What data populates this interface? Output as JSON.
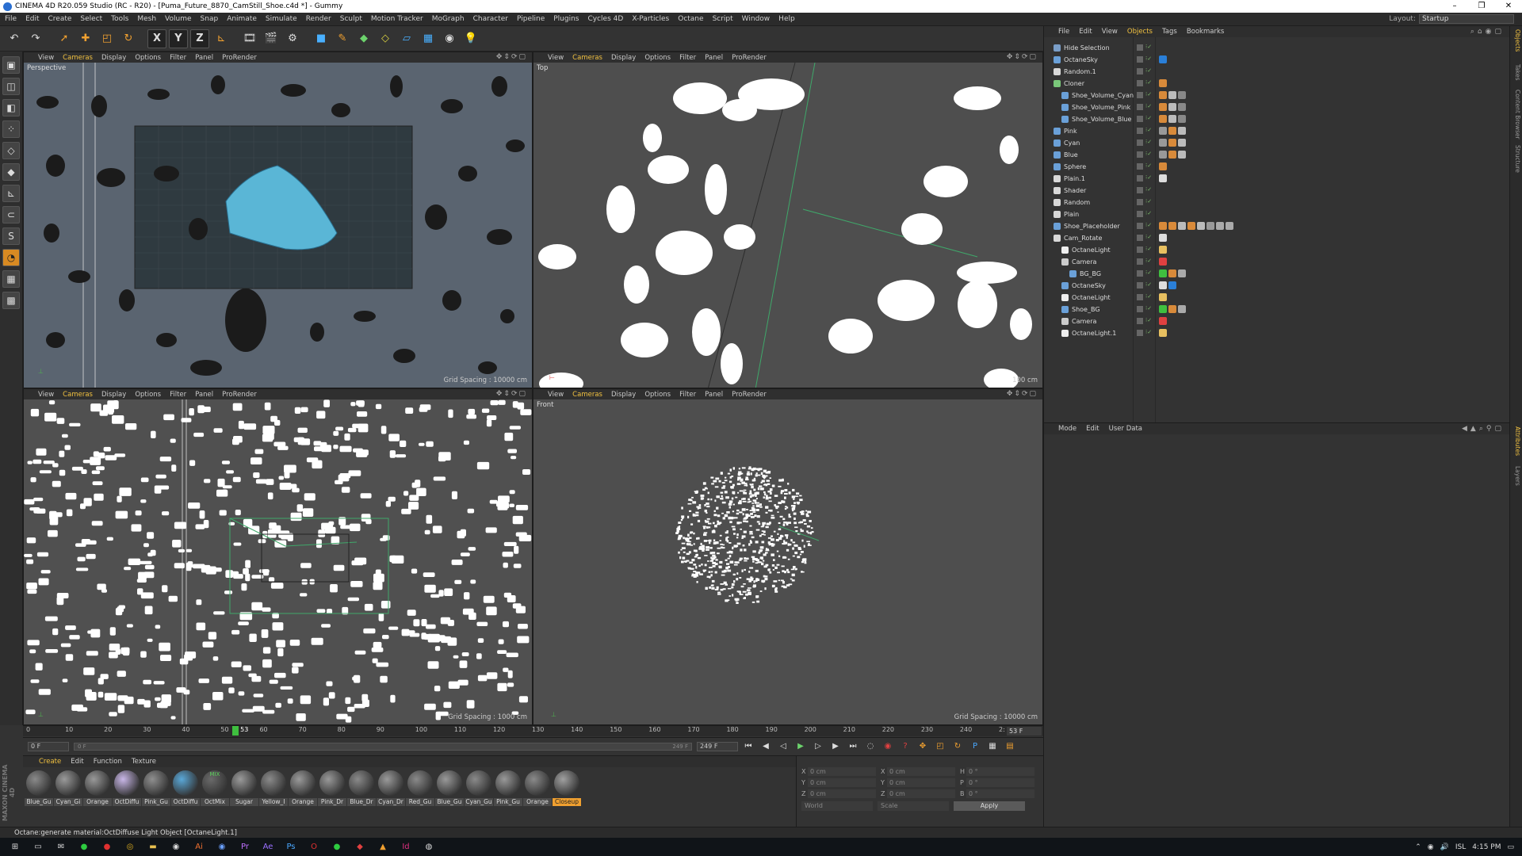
{
  "window": {
    "title": "CINEMA 4D R20.059 Studio (RC - R20) - [Puma_Future_8870_CamStill_Shoe.c4d *] - Gummy",
    "controls": [
      "–",
      "❐",
      "✕"
    ]
  },
  "menubar": {
    "items": [
      "File",
      "Edit",
      "Create",
      "Select",
      "Tools",
      "Mesh",
      "Volume",
      "Snap",
      "Animate",
      "Simulate",
      "Render",
      "Sculpt",
      "Motion Tracker",
      "MoGraph",
      "Character",
      "Pipeline",
      "Plugins",
      "Cycles 4D",
      "X-Particles",
      "Octane",
      "Script",
      "Window",
      "Help"
    ],
    "layout_label": "Layout:",
    "layout_value": "Startup"
  },
  "toolbar": {
    "axis_x": "X",
    "axis_y": "Y",
    "axis_z": "Z"
  },
  "viewports": {
    "menu": [
      "View",
      "Cameras",
      "Display",
      "Options",
      "Filter",
      "Panel",
      "ProRender"
    ],
    "perspective": {
      "label": "Perspective",
      "grid": "Grid Spacing : 10000 cm"
    },
    "top": {
      "label": "Top",
      "grid": "100 cm"
    },
    "right": {
      "label": "",
      "grid": "Grid Spacing : 1000 cm"
    },
    "front": {
      "label": "Front",
      "grid": "Grid Spacing : 10000 cm"
    }
  },
  "timeline": {
    "ticks": [
      "0",
      "10",
      "20",
      "30",
      "40",
      "50",
      "60",
      "70",
      "80",
      "90",
      "100",
      "110",
      "120",
      "130",
      "140",
      "150",
      "160",
      "170",
      "180",
      "190",
      "200",
      "210",
      "220",
      "230",
      "240",
      "2:"
    ],
    "current": "53",
    "current_fraction": 0.212,
    "end_field": "53 F"
  },
  "transport": {
    "start": "0 F",
    "range_start": "0 F",
    "range_end": "249 F",
    "end": "249 F"
  },
  "materials": {
    "menu": [
      "Create",
      "Edit",
      "Function",
      "Texture"
    ],
    "items": [
      {
        "name": "Blue_Gu",
        "color": "#8a8a8a"
      },
      {
        "name": "Cyan_Gi",
        "color": "#9a9a9a"
      },
      {
        "name": "Orange",
        "color": "#999999"
      },
      {
        "name": "OctDiffu",
        "color": "#c9b7e8"
      },
      {
        "name": "Pink_Gu",
        "color": "#8f8f8f"
      },
      {
        "name": "OctDiffu",
        "color": "#5aa8d8"
      },
      {
        "name": "OctMix",
        "color": "#6a6a6a"
      },
      {
        "name": "Sugar",
        "color": "#9a9a9a"
      },
      {
        "name": "Yellow_I",
        "color": "#8a8a8a"
      },
      {
        "name": "Orange",
        "color": "#9a9a9a"
      },
      {
        "name": "Pink_Dr",
        "color": "#999999"
      },
      {
        "name": "Blue_Dr",
        "color": "#8a8a8a"
      },
      {
        "name": "Cyan_Dr",
        "color": "#9a9a9a"
      },
      {
        "name": "Red_Gu",
        "color": "#8a8a8a"
      },
      {
        "name": "Blue_Gu",
        "color": "#999999"
      },
      {
        "name": "Cyan_Gu",
        "color": "#8a8a8a"
      },
      {
        "name": "Pink_Gu",
        "color": "#999999"
      },
      {
        "name": "Orange",
        "color": "#8a8a8a"
      },
      {
        "name": "Closeup",
        "color": "#a0a0a0"
      }
    ],
    "selected_index": 18,
    "mix_label": "MIX"
  },
  "coords": {
    "rows": [
      [
        {
          "l": "X",
          "v": "0 cm"
        },
        {
          "l": "X",
          "v": "0 cm"
        },
        {
          "l": "H",
          "v": "0 °"
        }
      ],
      [
        {
          "l": "Y",
          "v": "0 cm"
        },
        {
          "l": "Y",
          "v": "0 cm"
        },
        {
          "l": "P",
          "v": "0 °"
        }
      ],
      [
        {
          "l": "Z",
          "v": "0 cm"
        },
        {
          "l": "Z",
          "v": "0 cm"
        },
        {
          "l": "B",
          "v": "0 °"
        }
      ]
    ],
    "world": "World",
    "scale": "Scale",
    "apply": "Apply"
  },
  "status": {
    "text": "Octane:generate material:OctDiffuse     Light Object [OctaneLight.1]"
  },
  "maxon": "MAXON CINEMA 4D",
  "objects": {
    "menu": [
      "File",
      "Edit",
      "View",
      "Objects",
      "Tags",
      "Bookmarks"
    ],
    "items": [
      {
        "name": "Hide Selection",
        "indent": 0,
        "icon": "#7a9ec8",
        "tags": []
      },
      {
        "name": "OctaneSky",
        "indent": 0,
        "icon": "#6aa0d8",
        "tags": [
          "#2a7fd8"
        ]
      },
      {
        "name": "Random.1",
        "indent": 0,
        "icon": "#d8d8d8",
        "tags": []
      },
      {
        "name": "Cloner",
        "indent": 0,
        "icon": "#7ac87a",
        "tags": [
          "#d88a3a"
        ]
      },
      {
        "name": "Shoe_Volume_Cyan",
        "indent": 1,
        "icon": "#6aa0d8",
        "tags": [
          "#d88a3a",
          "#bbbbbb",
          "#888888"
        ]
      },
      {
        "name": "Shoe_Volume_Pink",
        "indent": 1,
        "icon": "#6aa0d8",
        "tags": [
          "#d88a3a",
          "#bbbbbb",
          "#888888"
        ]
      },
      {
        "name": "Shoe_Volume_Blue",
        "indent": 1,
        "icon": "#6aa0d8",
        "tags": [
          "#d88a3a",
          "#bbbbbb",
          "#888888"
        ]
      },
      {
        "name": "Pink",
        "indent": 0,
        "icon": "#6aa0d8",
        "tags": [
          "#999999",
          "#d88a3a",
          "#bbbbbb"
        ]
      },
      {
        "name": "Cyan",
        "indent": 0,
        "icon": "#6aa0d8",
        "tags": [
          "#999999",
          "#d88a3a",
          "#bbbbbb"
        ]
      },
      {
        "name": "Blue",
        "indent": 0,
        "icon": "#6aa0d8",
        "tags": [
          "#999999",
          "#d88a3a",
          "#bbbbbb"
        ]
      },
      {
        "name": "Sphere",
        "indent": 0,
        "icon": "#6aa0d8",
        "tags": [
          "#d88a3a"
        ]
      },
      {
        "name": "Plain.1",
        "indent": 0,
        "icon": "#d8d8d8",
        "tags": [
          "#dddddd"
        ]
      },
      {
        "name": "Shader",
        "indent": 0,
        "icon": "#d8d8d8",
        "tags": []
      },
      {
        "name": "Random",
        "indent": 0,
        "icon": "#d8d8d8",
        "tags": []
      },
      {
        "name": "Plain",
        "indent": 0,
        "icon": "#d8d8d8",
        "tags": []
      },
      {
        "name": "Shoe_Placeholder",
        "indent": 0,
        "icon": "#6aa0d8",
        "tags": [
          "#d88a3a",
          "#d88a3a",
          "#bbbbbb",
          "#d88a3a",
          "#bbbbbb",
          "#999999",
          "#aaaaaa",
          "#aaaaaa"
        ]
      },
      {
        "name": "Cam_Rotate",
        "indent": 0,
        "icon": "#d8d8d8",
        "tags": [
          "#dddddd"
        ]
      },
      {
        "name": "OctaneLight",
        "indent": 1,
        "icon": "#eeeeee",
        "tags": [
          "#e8c060"
        ]
      },
      {
        "name": "Camera",
        "indent": 1,
        "icon": "#cccccc",
        "tags": [
          "#e04040"
        ]
      },
      {
        "name": "BG_BG",
        "indent": 2,
        "icon": "#6aa0d8",
        "tags": [
          "#3fbf3f",
          "#d88a3a",
          "#aaaaaa"
        ]
      },
      {
        "name": "OctaneSky",
        "indent": 1,
        "icon": "#6aa0d8",
        "tags": [
          "#dddddd",
          "#2a7fd8"
        ]
      },
      {
        "name": "OctaneLight",
        "indent": 1,
        "icon": "#eeeeee",
        "tags": [
          "#e8c060"
        ]
      },
      {
        "name": "Shoe_BG",
        "indent": 1,
        "icon": "#6aa0d8",
        "tags": [
          "#3fbf3f",
          "#d88a3a",
          "#aaaaaa"
        ]
      },
      {
        "name": "Camera",
        "indent": 1,
        "icon": "#cccccc",
        "tags": [
          "#e04040"
        ]
      },
      {
        "name": "OctaneLight.1",
        "indent": 1,
        "icon": "#eeeeee",
        "tags": [
          "#e8c060"
        ]
      }
    ]
  },
  "attributes": {
    "menu": [
      "Mode",
      "Edit",
      "User Data"
    ]
  },
  "right_tabs": [
    "Objects",
    "Takes",
    "Content Browser",
    "Structure",
    "Attributes",
    "Layers"
  ],
  "tray": {
    "lang": "ISL",
    "time": "4:15 PM"
  },
  "icons": {
    "toolbar": [
      "undo-icon",
      "redo-icon",
      "select-icon",
      "move-icon",
      "scale-icon",
      "rotate-icon",
      "render-icon",
      "cube-icon",
      "pen-icon",
      "subdivide-icon",
      "deformer-icon",
      "floor-icon",
      "camera-icon",
      "light-icon"
    ],
    "left": [
      "make-editable-icon",
      "model-icon",
      "texture-icon",
      "points-icon",
      "edges-icon",
      "polygons-icon",
      "axis-icon",
      "snap-icon",
      "tweak-icon",
      "solo-icon",
      "workplane-icon",
      "grid-icon"
    ]
  }
}
